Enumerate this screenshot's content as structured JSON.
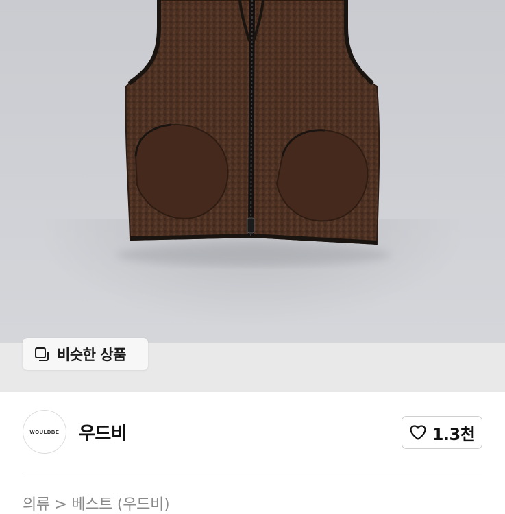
{
  "product_image": {
    "alt_icon": "brown-fleece-vest-photo"
  },
  "similar_products": {
    "icon": "copy-squares-icon",
    "label": "비슷한 상품"
  },
  "seller": {
    "avatar_text": "WOULDBE",
    "name": "우드비"
  },
  "like": {
    "icon": "heart-outline-icon",
    "count": "1.3천"
  },
  "breadcrumb": {
    "text": "의류 > 베스트 (우드비)"
  },
  "colors": {
    "vest_brown": "#4a3022",
    "background_gray": "#cfd1d6",
    "chip_bg": "#f7f7f7",
    "strip_bg": "#e9e9ea"
  }
}
